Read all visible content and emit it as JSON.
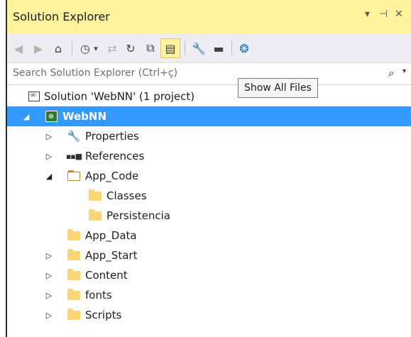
{
  "panel": {
    "title": "Solution Explorer",
    "title_buttons": [
      "▾",
      "⊣",
      "✕"
    ]
  },
  "toolbar": {
    "buttons": [
      {
        "icon": "back-icon",
        "glyph": "◀"
      },
      {
        "icon": "forward-icon",
        "glyph": "▶"
      },
      {
        "icon": "home-icon",
        "glyph": "⌂"
      },
      {
        "icon": "pending-changes-filter-icon",
        "glyph": "◷"
      },
      {
        "icon": "dropdown-arrow-icon",
        "glyph": "▾"
      },
      {
        "icon": "sync-active-document-icon",
        "glyph": "⇄"
      },
      {
        "icon": "refresh-icon",
        "glyph": "↻"
      },
      {
        "icon": "collapse-all-icon",
        "glyph": "⧉"
      },
      {
        "icon": "show-all-files-icon",
        "glyph": "▤"
      },
      {
        "icon": "properties-wrench-icon",
        "glyph": "🔧"
      },
      {
        "icon": "preview-selected-items-icon",
        "glyph": "▬"
      },
      {
        "icon": "browser-link-icon",
        "glyph": "❂"
      }
    ]
  },
  "search": {
    "placeholder": "Search Solution Explorer (Ctrl+ç)",
    "icon_glyph": "⌕",
    "dropdown_glyph": "▾"
  },
  "tooltip": {
    "text": "Show All Files"
  },
  "tree": {
    "solution_label": "Solution 'WebNN' (1 project)",
    "project_label": "WebNN",
    "items": [
      {
        "label": "Properties"
      },
      {
        "label": "References"
      },
      {
        "label": "App_Code"
      },
      {
        "label": "Classes"
      },
      {
        "label": "Persistencia"
      },
      {
        "label": "App_Data"
      },
      {
        "label": "App_Start"
      },
      {
        "label": "Content"
      },
      {
        "label": "fonts"
      },
      {
        "label": "Scripts"
      }
    ]
  },
  "colors": {
    "title_bar": "#fff29d",
    "selection": "#3399ff",
    "folder": "#f8d675"
  }
}
